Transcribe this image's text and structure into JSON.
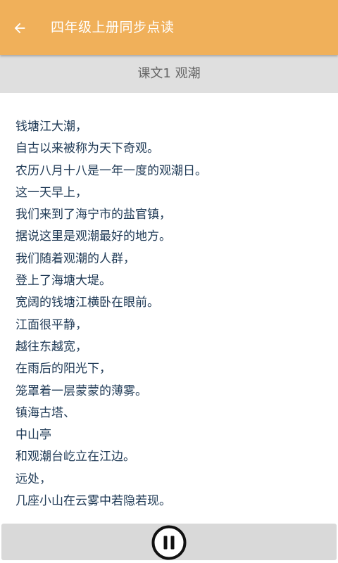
{
  "toolbar": {
    "title": "四年级上册同步点读",
    "back_icon": "arrow-back-icon"
  },
  "lesson": {
    "title": "课文1 观潮"
  },
  "text_lines": [
    "钱塘江大潮，",
    "自古以来被称为天下奇观。",
    "农历八月十八是一年一度的观潮日。",
    "这一天早上，",
    "我们来到了海宁市的盐官镇，",
    "据说这里是观潮最好的地方。",
    "我们随着观潮的人群，",
    "登上了海塘大堤。",
    "宽阔的钱塘江横卧在眼前。",
    "江面很平静，",
    "越往东越宽，",
    "在雨后的阳光下，",
    "笼罩着一层蒙蒙的薄雾。",
    "镇海古塔、",
    "中山亭",
    "和观潮台屹立在江边。",
    "远处，",
    "几座小山在云雾中若隐若现。"
  ],
  "player": {
    "state_icon": "pause-icon"
  },
  "colors": {
    "toolbar": "#f0b05a",
    "lesson_bar": "#dfdfdf",
    "text": "#1f3a56",
    "player_bar": "#d9d9d9"
  }
}
